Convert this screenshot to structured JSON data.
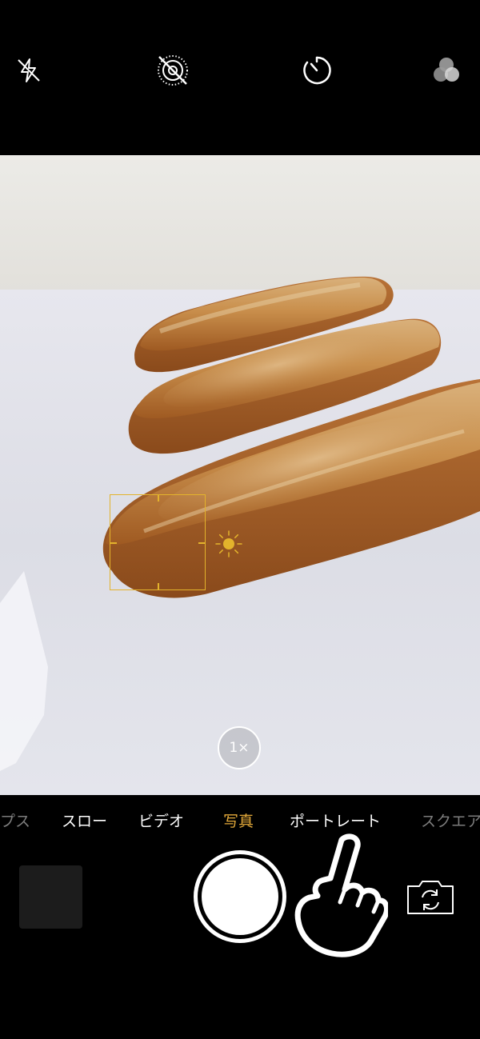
{
  "top_bar": {
    "icons": [
      "flash-off-icon",
      "live-photo-off-icon",
      "timer-icon",
      "filters-icon"
    ]
  },
  "viewfinder": {
    "subject": "three baguettes on a white table",
    "zoom_label": "1×"
  },
  "mode_bar": {
    "modes": [
      {
        "label": "プス",
        "state": "faded"
      },
      {
        "label": "スロー",
        "state": "normal"
      },
      {
        "label": "ビデオ",
        "state": "normal"
      },
      {
        "label": "写真",
        "state": "active"
      },
      {
        "label": "ポートレート",
        "state": "normal"
      },
      {
        "label": "スクエア",
        "state": "faded"
      }
    ],
    "active_color": "#e3a93a"
  },
  "bottom_bar": {
    "icons": [
      "photo-thumbnail",
      "shutter-button",
      "hand-pointer-icon",
      "camera-flip-icon"
    ]
  },
  "colors": {
    "focus_box": "#e3b32c",
    "background": "#000000"
  }
}
